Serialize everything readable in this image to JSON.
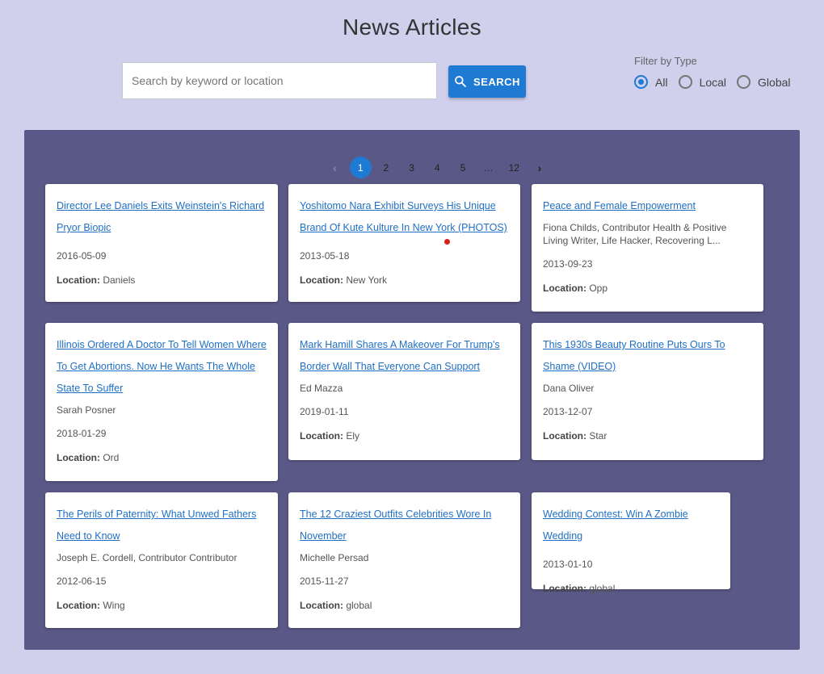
{
  "header": {
    "title": "News Articles"
  },
  "search": {
    "placeholder": "Search by keyword or location",
    "value": "",
    "button_label": "SEARCH"
  },
  "filter": {
    "label": "Filter by Type",
    "options": [
      {
        "label": "All",
        "checked": true
      },
      {
        "label": "Local",
        "checked": false
      },
      {
        "label": "Global",
        "checked": false
      }
    ]
  },
  "pagination": {
    "prev": "‹",
    "next": "›",
    "pages": [
      "1",
      "2",
      "3",
      "4",
      "5",
      "…",
      "12"
    ],
    "current": "1"
  },
  "location_label": "Location:",
  "articles": [
    {
      "title": "Director Lee Daniels Exits Weinstein's Richard Pryor Biopic",
      "author": "",
      "date": "2016-05-09",
      "location": "Daniels"
    },
    {
      "title": "Yoshitomo Nara Exhibit Surveys His Unique Brand Of Kute Kulture In New York (PHOTOS)",
      "author": "",
      "date": "2013-05-18",
      "location": "New York"
    },
    {
      "title": "Peace and Female Empowerment",
      "author": "Fiona Childs, Contributor Health & Positive Living Writer, Life Hacker, Recovering L...",
      "date": "2013-09-23",
      "location": "Opp"
    },
    {
      "title": "Illinois Ordered A Doctor To Tell Women Where To Get Abortions. Now He Wants The Whole State To Suffer",
      "author": "Sarah Posner",
      "date": "2018-01-29",
      "location": "Ord"
    },
    {
      "title": "Mark Hamill Shares A Makeover For Trump's Border Wall That Everyone Can Support",
      "author": "Ed Mazza",
      "date": "2019-01-11",
      "location": "Ely"
    },
    {
      "title": "This 1930s Beauty Routine Puts Ours To Shame (VIDEO)",
      "author": "Dana Oliver",
      "date": "2013-12-07",
      "location": "Star"
    },
    {
      "title": "The Perils of Paternity: What Unwed Fathers Need to Know",
      "author": "Joseph E. Cordell, Contributor Contributor",
      "date": "2012-06-15",
      "location": "Wing"
    },
    {
      "title": "The 12 Craziest Outfits Celebrities Wore In November",
      "author": "Michelle Persad",
      "date": "2015-11-27",
      "location": "global"
    },
    {
      "title": "Wedding Contest: Win A Zombie Wedding",
      "author": "",
      "date": "2013-01-10",
      "location": "global"
    }
  ],
  "colors": {
    "background": "#d0cfec",
    "panel": "#5a5886",
    "accent": "#1f7ad3",
    "link": "#1f6fc4",
    "cursor": "#d8201c"
  }
}
